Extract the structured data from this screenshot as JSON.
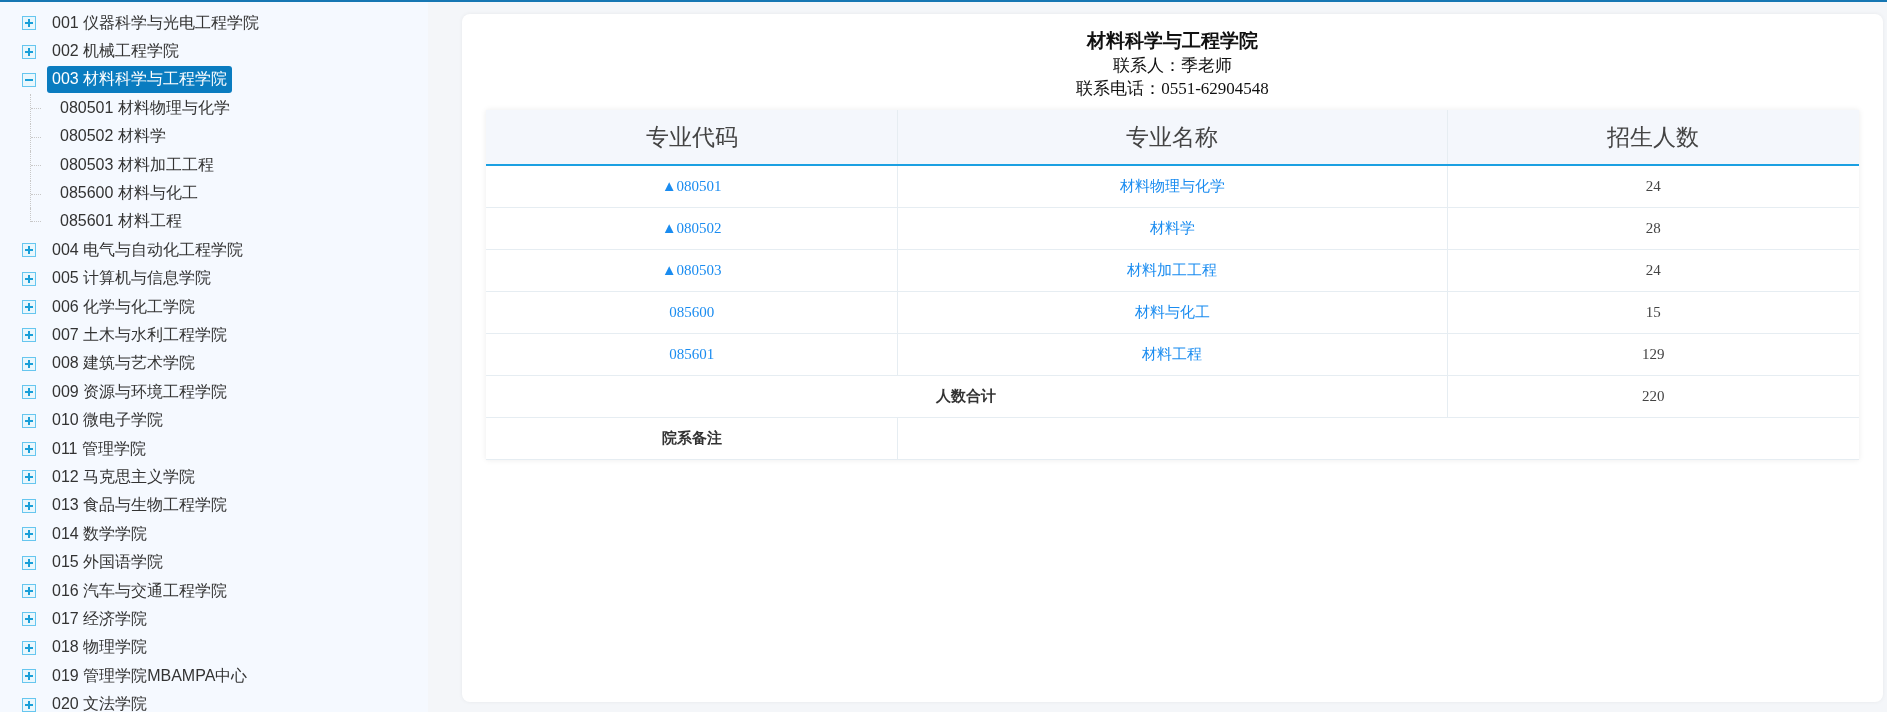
{
  "sidebar": {
    "tree": [
      {
        "label": "001 仪器科学与光电工程学院",
        "selected": false,
        "expanded": false
      },
      {
        "label": "002 机械工程学院",
        "selected": false,
        "expanded": false
      },
      {
        "label": "003 材料科学与工程学院",
        "selected": true,
        "expanded": true,
        "children": [
          {
            "label": "080501 材料物理与化学",
            "selected": false
          },
          {
            "label": "080502 材料学",
            "selected": false
          },
          {
            "label": "080503 材料加工工程",
            "selected": false
          },
          {
            "label": "085600 材料与化工",
            "selected": false
          },
          {
            "label": "085601 材料工程",
            "selected": false
          }
        ]
      },
      {
        "label": "004 电气与自动化工程学院",
        "selected": false,
        "expanded": false
      },
      {
        "label": "005 计算机与信息学院",
        "selected": false,
        "expanded": false
      },
      {
        "label": "006 化学与化工学院",
        "selected": false,
        "expanded": false
      },
      {
        "label": "007 土木与水利工程学院",
        "selected": false,
        "expanded": false
      },
      {
        "label": "008 建筑与艺术学院",
        "selected": false,
        "expanded": false
      },
      {
        "label": "009 资源与环境工程学院",
        "selected": false,
        "expanded": false
      },
      {
        "label": "010 微电子学院",
        "selected": false,
        "expanded": false
      },
      {
        "label": "011 管理学院",
        "selected": false,
        "expanded": false
      },
      {
        "label": "012 马克思主义学院",
        "selected": false,
        "expanded": false
      },
      {
        "label": "013 食品与生物工程学院",
        "selected": false,
        "expanded": false
      },
      {
        "label": "014 数学学院",
        "selected": false,
        "expanded": false
      },
      {
        "label": "015 外国语学院",
        "selected": false,
        "expanded": false
      },
      {
        "label": "016 汽车与交通工程学院",
        "selected": false,
        "expanded": false
      },
      {
        "label": "017 经济学院",
        "selected": false,
        "expanded": false
      },
      {
        "label": "018 物理学院",
        "selected": false,
        "expanded": false
      },
      {
        "label": "019 管理学院MBAMPA中心",
        "selected": false,
        "expanded": false
      },
      {
        "label": "020 文法学院",
        "selected": false,
        "expanded": false
      }
    ]
  },
  "detail": {
    "title": "材料科学与工程学院",
    "contact": "联系人：季老师",
    "phone": "联系电话：0551-62904548",
    "table": {
      "columns": [
        "专业代码",
        "专业名称",
        "招生人数"
      ],
      "rows": [
        {
          "code": "▲080501",
          "name": "材料物理与化学",
          "count": "24"
        },
        {
          "code": "▲080502",
          "name": "材料学",
          "count": "28"
        },
        {
          "code": "▲080503",
          "name": "材料加工工程",
          "count": "24"
        },
        {
          "code": "085600",
          "name": "材料与化工",
          "count": "15"
        },
        {
          "code": "085601",
          "name": "材料工程",
          "count": "129"
        }
      ],
      "total": {
        "label": "人数合计",
        "value": "220"
      },
      "remark": {
        "label": "院系备注"
      }
    }
  }
}
